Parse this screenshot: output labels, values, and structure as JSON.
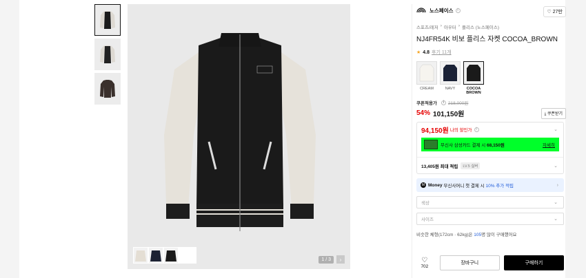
{
  "gallery": {
    "counter": "1 / 3",
    "next_icon": "chevron-right-icon",
    "thumbnails": [
      "front-jacket",
      "back-jacket",
      "dark-jacket"
    ]
  },
  "product": {
    "brand": "노스페이스",
    "likes": "27만",
    "breadcrumb": [
      "스포츠/레저",
      "아우터",
      "플리스 (노스페이스)"
    ],
    "title": "NJ4FR54K 비보 플리스 자켓 COCOA_BROWN",
    "rating": "4.8",
    "reviews": "후기 11개",
    "colors": [
      {
        "label": "CREAM"
      },
      {
        "label": "NAVY"
      },
      {
        "label": "COCOA BROWN"
      }
    ]
  },
  "pricing": {
    "label": "쿠폰적용가",
    "original": "218,000원",
    "rate": "54%",
    "price": "101,150원",
    "coupon_button": "쿠폰받기",
    "my_price": "94,150원",
    "my_price_label": "나의 할인가",
    "card_text_pre": "무신사 삼성카드 결제 시",
    "card_price": "68,150원",
    "card_more": "자세히",
    "points_text": "13,405원 최대 적립",
    "points_level": "LV.5 실버",
    "money_pre": "무신사머니 첫 결제 시",
    "money_rate": "10% 추가 적립",
    "money_brand": "Money"
  },
  "options": {
    "color_placeholder": "색상",
    "size_placeholder": "사이즈",
    "fit_pre": "비슷한 체형(172cm · 62kg)은",
    "fit_count": "105",
    "fit_post": "명 많이 구매했어요"
  },
  "actions": {
    "wish_count": "702",
    "cart": "장바구니",
    "buy": "구매하기"
  },
  "colors": {
    "accent_red": "#e60000",
    "card_banner": "#00ff2a",
    "money_bg": "#eaf2ff",
    "buy_bg": "#000000"
  }
}
